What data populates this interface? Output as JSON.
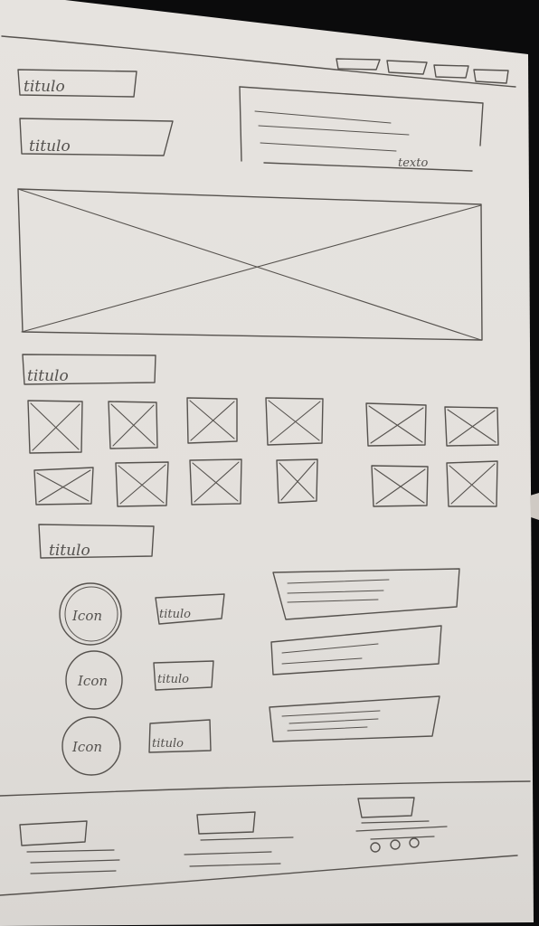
{
  "labels": {
    "title_1": "titulo",
    "title_2": "titulo",
    "text_block": "texto",
    "gallery_title": "titulo",
    "features_title": "titulo",
    "icon_1": "Icon",
    "icon_2": "Icon",
    "icon_3": "Icon",
    "feature_title_1": "titulo",
    "feature_title_2": "titulo",
    "feature_title_3": "titulo"
  },
  "nav": {
    "items_count": 4
  },
  "gallery": {
    "rows": 2,
    "columns": 6
  },
  "footer": {
    "pagination_dots": 3
  },
  "colors": {
    "paper": "#e7e4e0",
    "pencil": "#56524e",
    "background": "#0b0b0c"
  }
}
